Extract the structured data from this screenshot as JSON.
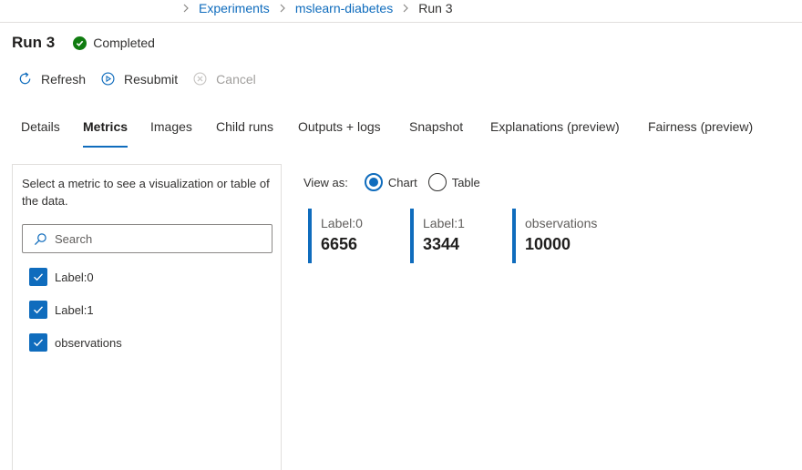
{
  "breadcrumb": {
    "items": [
      "Experiments",
      "mslearn-diabetes",
      "Run 3"
    ]
  },
  "header": {
    "title": "Run 3",
    "status": "Completed",
    "status_color": "#107c10"
  },
  "commands": {
    "refresh": "Refresh",
    "resubmit": "Resubmit",
    "cancel": "Cancel"
  },
  "tabs": [
    {
      "label": "Details"
    },
    {
      "label": "Metrics",
      "active": true
    },
    {
      "label": "Images"
    },
    {
      "label": "Child runs"
    },
    {
      "label": "Outputs + logs"
    },
    {
      "label": "Snapshot"
    },
    {
      "label": "Explanations (preview)"
    },
    {
      "label": "Fairness (preview)"
    }
  ],
  "metrics_panel": {
    "description": "Select a metric to see a visualization or table of the data.",
    "search_placeholder": "Search",
    "items": [
      {
        "label": "Label:0",
        "checked": true
      },
      {
        "label": "Label:1",
        "checked": true
      },
      {
        "label": "observations",
        "checked": true
      }
    ]
  },
  "view_as": {
    "label": "View as:",
    "options": [
      "Chart",
      "Table"
    ],
    "selected": "Chart"
  },
  "metric_cards": [
    {
      "label": "Label:0",
      "value": "6656"
    },
    {
      "label": "Label:1",
      "value": "3344"
    },
    {
      "label": "observations",
      "value": "10000"
    }
  ],
  "colors": {
    "accent": "#0f6cbd",
    "success": "#107c10"
  }
}
